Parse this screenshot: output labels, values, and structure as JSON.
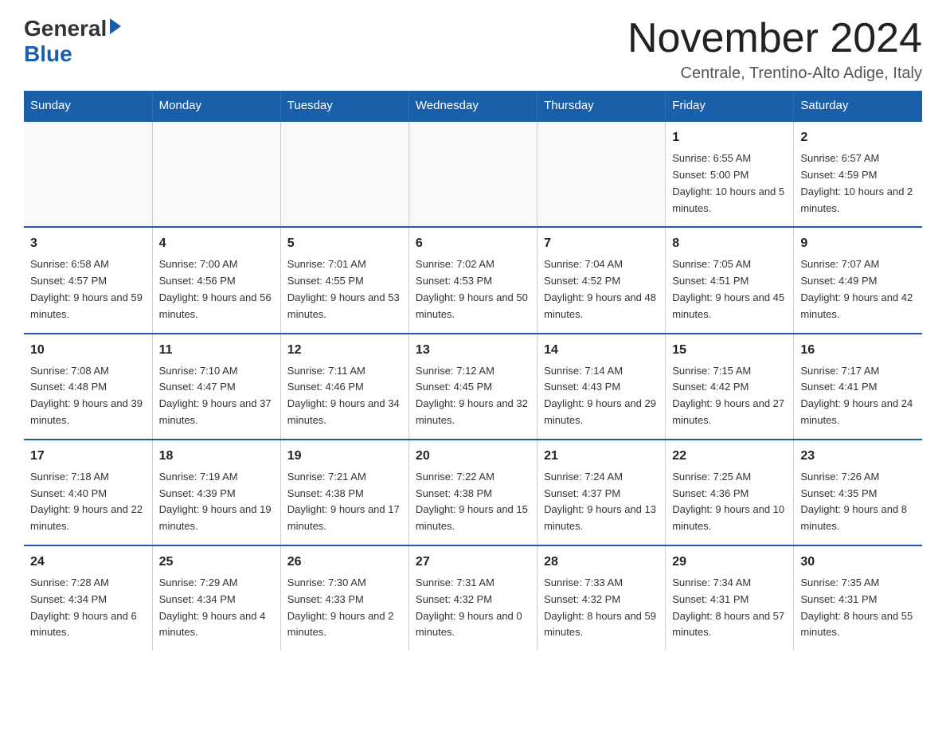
{
  "header": {
    "logo_general": "General",
    "logo_blue": "Blue",
    "title": "November 2024",
    "location": "Centrale, Trentino-Alto Adige, Italy"
  },
  "calendar": {
    "days_of_week": [
      "Sunday",
      "Monday",
      "Tuesday",
      "Wednesday",
      "Thursday",
      "Friday",
      "Saturday"
    ],
    "weeks": [
      [
        {
          "day": "",
          "info": ""
        },
        {
          "day": "",
          "info": ""
        },
        {
          "day": "",
          "info": ""
        },
        {
          "day": "",
          "info": ""
        },
        {
          "day": "",
          "info": ""
        },
        {
          "day": "1",
          "info": "Sunrise: 6:55 AM\nSunset: 5:00 PM\nDaylight: 10 hours and 5 minutes."
        },
        {
          "day": "2",
          "info": "Sunrise: 6:57 AM\nSunset: 4:59 PM\nDaylight: 10 hours and 2 minutes."
        }
      ],
      [
        {
          "day": "3",
          "info": "Sunrise: 6:58 AM\nSunset: 4:57 PM\nDaylight: 9 hours and 59 minutes."
        },
        {
          "day": "4",
          "info": "Sunrise: 7:00 AM\nSunset: 4:56 PM\nDaylight: 9 hours and 56 minutes."
        },
        {
          "day": "5",
          "info": "Sunrise: 7:01 AM\nSunset: 4:55 PM\nDaylight: 9 hours and 53 minutes."
        },
        {
          "day": "6",
          "info": "Sunrise: 7:02 AM\nSunset: 4:53 PM\nDaylight: 9 hours and 50 minutes."
        },
        {
          "day": "7",
          "info": "Sunrise: 7:04 AM\nSunset: 4:52 PM\nDaylight: 9 hours and 48 minutes."
        },
        {
          "day": "8",
          "info": "Sunrise: 7:05 AM\nSunset: 4:51 PM\nDaylight: 9 hours and 45 minutes."
        },
        {
          "day": "9",
          "info": "Sunrise: 7:07 AM\nSunset: 4:49 PM\nDaylight: 9 hours and 42 minutes."
        }
      ],
      [
        {
          "day": "10",
          "info": "Sunrise: 7:08 AM\nSunset: 4:48 PM\nDaylight: 9 hours and 39 minutes."
        },
        {
          "day": "11",
          "info": "Sunrise: 7:10 AM\nSunset: 4:47 PM\nDaylight: 9 hours and 37 minutes."
        },
        {
          "day": "12",
          "info": "Sunrise: 7:11 AM\nSunset: 4:46 PM\nDaylight: 9 hours and 34 minutes."
        },
        {
          "day": "13",
          "info": "Sunrise: 7:12 AM\nSunset: 4:45 PM\nDaylight: 9 hours and 32 minutes."
        },
        {
          "day": "14",
          "info": "Sunrise: 7:14 AM\nSunset: 4:43 PM\nDaylight: 9 hours and 29 minutes."
        },
        {
          "day": "15",
          "info": "Sunrise: 7:15 AM\nSunset: 4:42 PM\nDaylight: 9 hours and 27 minutes."
        },
        {
          "day": "16",
          "info": "Sunrise: 7:17 AM\nSunset: 4:41 PM\nDaylight: 9 hours and 24 minutes."
        }
      ],
      [
        {
          "day": "17",
          "info": "Sunrise: 7:18 AM\nSunset: 4:40 PM\nDaylight: 9 hours and 22 minutes."
        },
        {
          "day": "18",
          "info": "Sunrise: 7:19 AM\nSunset: 4:39 PM\nDaylight: 9 hours and 19 minutes."
        },
        {
          "day": "19",
          "info": "Sunrise: 7:21 AM\nSunset: 4:38 PM\nDaylight: 9 hours and 17 minutes."
        },
        {
          "day": "20",
          "info": "Sunrise: 7:22 AM\nSunset: 4:38 PM\nDaylight: 9 hours and 15 minutes."
        },
        {
          "day": "21",
          "info": "Sunrise: 7:24 AM\nSunset: 4:37 PM\nDaylight: 9 hours and 13 minutes."
        },
        {
          "day": "22",
          "info": "Sunrise: 7:25 AM\nSunset: 4:36 PM\nDaylight: 9 hours and 10 minutes."
        },
        {
          "day": "23",
          "info": "Sunrise: 7:26 AM\nSunset: 4:35 PM\nDaylight: 9 hours and 8 minutes."
        }
      ],
      [
        {
          "day": "24",
          "info": "Sunrise: 7:28 AM\nSunset: 4:34 PM\nDaylight: 9 hours and 6 minutes."
        },
        {
          "day": "25",
          "info": "Sunrise: 7:29 AM\nSunset: 4:34 PM\nDaylight: 9 hours and 4 minutes."
        },
        {
          "day": "26",
          "info": "Sunrise: 7:30 AM\nSunset: 4:33 PM\nDaylight: 9 hours and 2 minutes."
        },
        {
          "day": "27",
          "info": "Sunrise: 7:31 AM\nSunset: 4:32 PM\nDaylight: 9 hours and 0 minutes."
        },
        {
          "day": "28",
          "info": "Sunrise: 7:33 AM\nSunset: 4:32 PM\nDaylight: 8 hours and 59 minutes."
        },
        {
          "day": "29",
          "info": "Sunrise: 7:34 AM\nSunset: 4:31 PM\nDaylight: 8 hours and 57 minutes."
        },
        {
          "day": "30",
          "info": "Sunrise: 7:35 AM\nSunset: 4:31 PM\nDaylight: 8 hours and 55 minutes."
        }
      ]
    ]
  }
}
